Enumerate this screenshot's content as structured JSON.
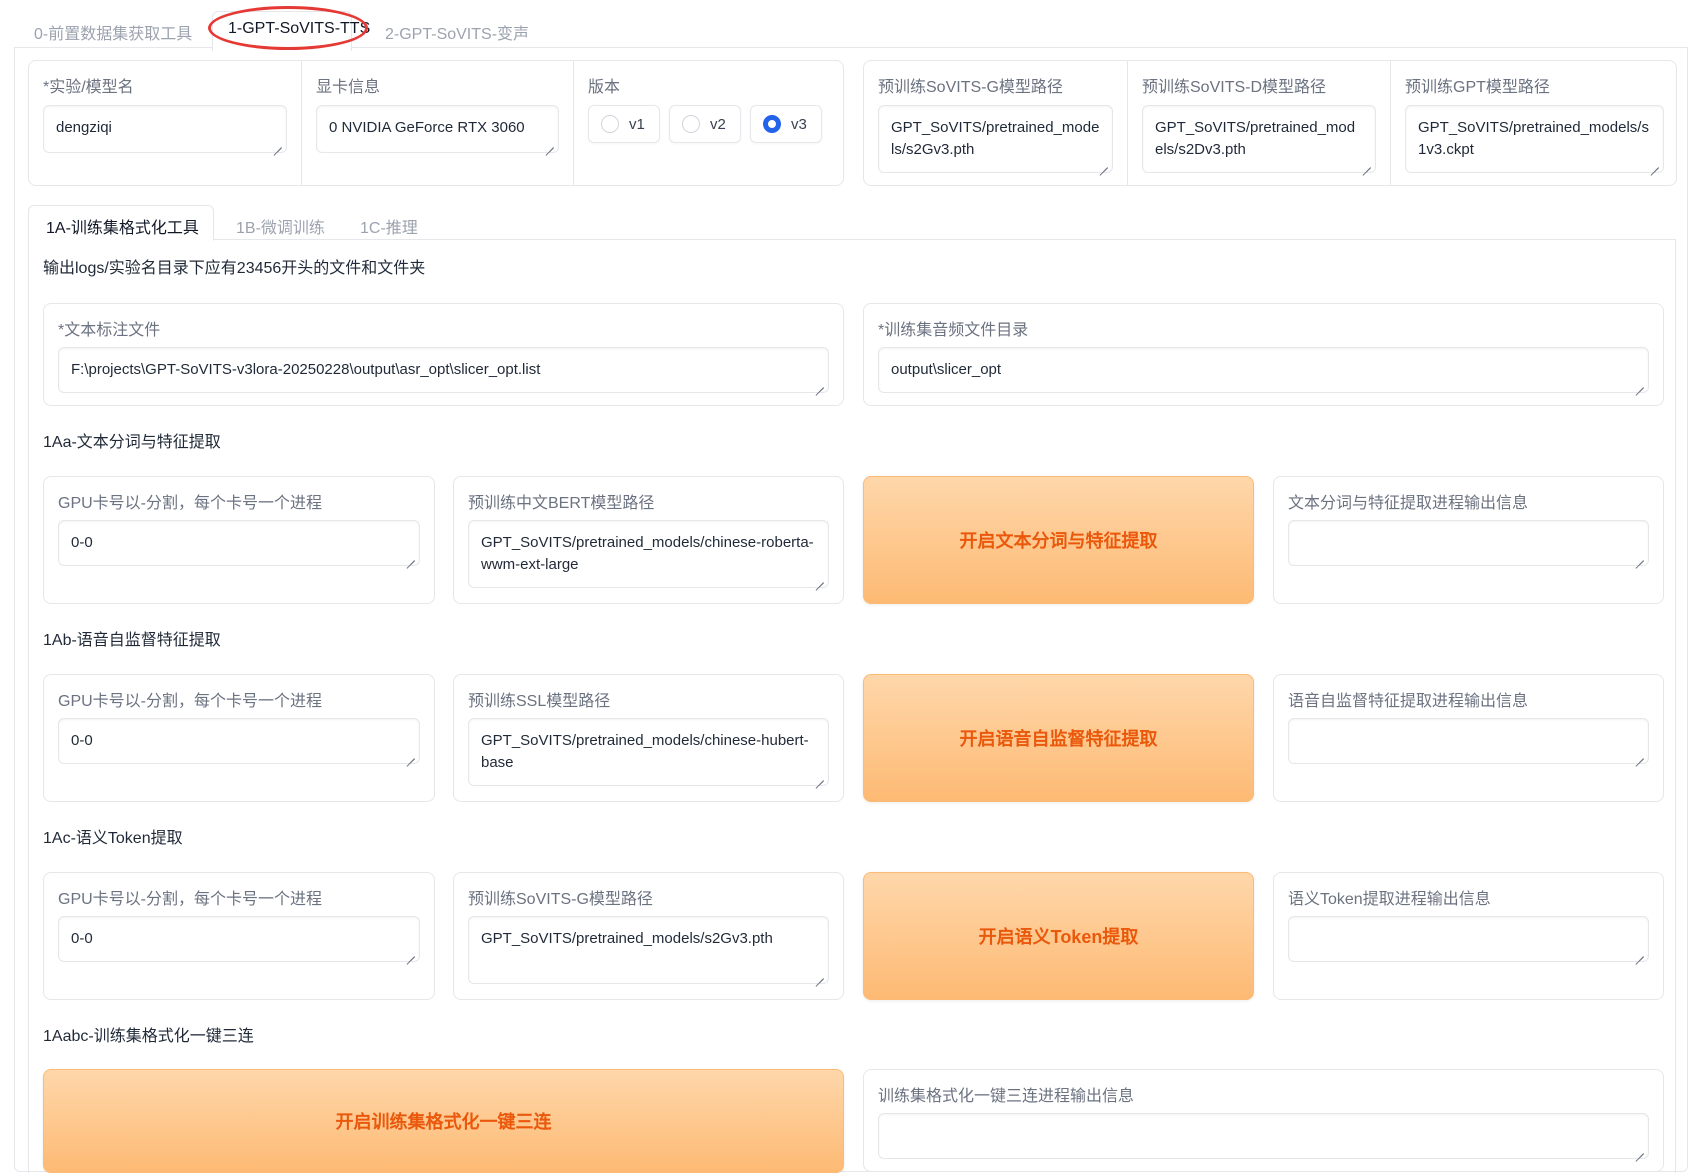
{
  "top_tabs": [
    "0-前置数据集获取工具",
    "1-GPT-SoVITS-TTS",
    "2-GPT-SoVITS-变声"
  ],
  "config": {
    "exp_name_label": "*实验/模型名",
    "exp_name_value": "dengziqi",
    "gpu_info_label": "显卡信息",
    "gpu_info_value": "0 NVIDIA GeForce RTX 3060",
    "version_label": "版本",
    "versions": [
      "v1",
      "v2",
      "v3"
    ],
    "version_selected": "v3",
    "sovits_g_label": "预训练SoVITS-G模型路径",
    "sovits_g_value": "GPT_SoVITS/pretrained_models/s2Gv3.pth",
    "sovits_d_label": "预训练SoVITS-D模型路径",
    "sovits_d_value": "GPT_SoVITS/pretrained_models/s2Dv3.pth",
    "gpt_label": "预训练GPT模型路径",
    "gpt_value": "GPT_SoVITS/pretrained_models/s1v3.ckpt"
  },
  "inner_tabs": [
    "1A-训练集格式化工具",
    "1B-微调训练",
    "1C-推理"
  ],
  "info_note": "输出logs/实验名目录下应有23456开头的文件和文件夹",
  "inputs": {
    "text_label": "*文本标注文件",
    "text_value": "F:\\projects\\GPT-SoVITS-v3lora-20250228\\output\\asr_opt\\slicer_opt.list",
    "audio_label": "*训练集音频文件目录",
    "audio_value": "output\\slicer_opt"
  },
  "section_a": {
    "title": "1Aa-文本分词与特征提取",
    "gpu_label": "GPU卡号以-分割，每个卡号一个进程",
    "gpu_value": "0-0",
    "model_label": "预训练中文BERT模型路径",
    "model_value": "GPT_SoVITS/pretrained_models/chinese-roberta-wwm-ext-large",
    "button": "开启文本分词与特征提取",
    "output_label": "文本分词与特征提取进程输出信息",
    "output_value": ""
  },
  "section_b": {
    "title": "1Ab-语音自监督特征提取",
    "gpu_label": "GPU卡号以-分割，每个卡号一个进程",
    "gpu_value": "0-0",
    "model_label": "预训练SSL模型路径",
    "model_value": "GPT_SoVITS/pretrained_models/chinese-hubert-base",
    "button": "开启语音自监督特征提取",
    "output_label": "语音自监督特征提取进程输出信息",
    "output_value": ""
  },
  "section_c": {
    "title": "1Ac-语义Token提取",
    "gpu_label": "GPU卡号以-分割，每个卡号一个进程",
    "gpu_value": "0-0",
    "model_label": "预训练SoVITS-G模型路径",
    "model_value": "GPT_SoVITS/pretrained_models/s2Gv3.pth",
    "button": "开启语义Token提取",
    "output_label": "语义Token提取进程输出信息",
    "output_value": ""
  },
  "section_d": {
    "title": "1Aabc-训练集格式化一键三连",
    "button": "开启训练集格式化一键三连",
    "output_label": "训练集格式化一键三连进程输出信息",
    "output_value": ""
  },
  "colors": {
    "accent_orange": "#ea580c",
    "radio_blue": "#2563eb",
    "highlight_red": "#e53935"
  }
}
